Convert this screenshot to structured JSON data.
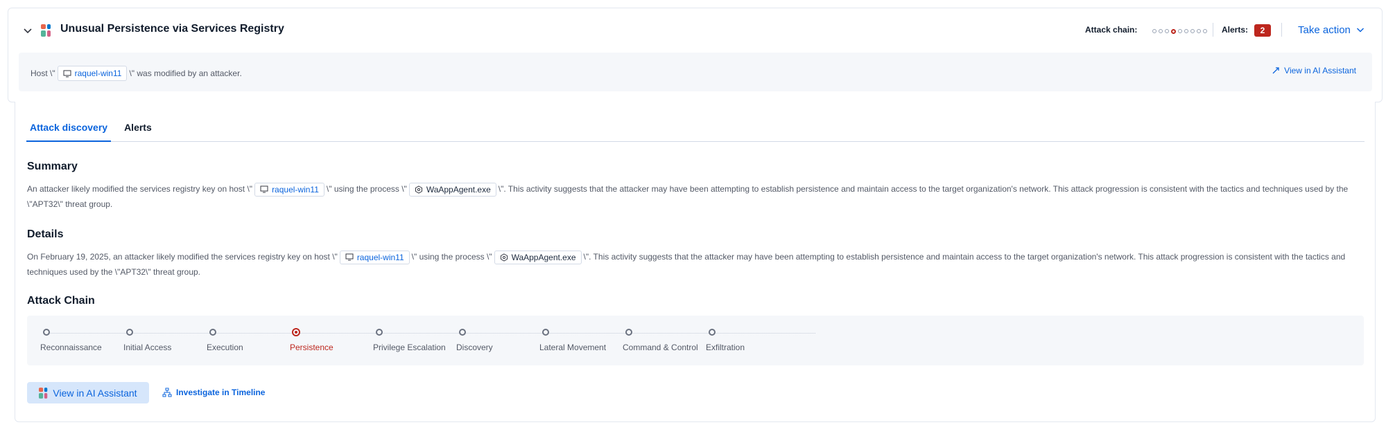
{
  "header": {
    "title": "Unusual Persistence via Services Registry",
    "attack_chain_label": "Attack chain:",
    "alerts_label": "Alerts:",
    "alerts_count": "2",
    "take_action_label": "Take action"
  },
  "host_banner": {
    "prefix": "Host \\\"",
    "host": "raquel-win11",
    "suffix": "\\\" was modified by an attacker.",
    "view_ai_label": "View in AI Assistant"
  },
  "tabs": [
    {
      "label": "Attack discovery",
      "active": true
    },
    {
      "label": "Alerts",
      "active": false
    }
  ],
  "summary": {
    "heading": "Summary",
    "t1": "An attacker likely modified the services registry key on host \\\"",
    "host": "raquel-win11",
    "t2": "\\\" using the process \\\"",
    "process": "WaAppAgent.exe",
    "t3": "\\\". This activity suggests that the attacker may have been attempting to establish persistence and maintain access to the target organization's network. This attack progression is consistent with the tactics and techniques used by the \\\"APT32\\\" threat group."
  },
  "details": {
    "heading": "Details",
    "t1": "On February 19, 2025, an attacker likely modified the services registry key on host \\\"",
    "host": "raquel-win11",
    "t2": "\\\" using the process \\\"",
    "process": "WaAppAgent.exe",
    "t3": "\\\". This activity suggests that the attacker may have been attempting to establish persistence and maintain access to the target organization's network. This attack progression is consistent with the tactics and techniques used by the \\\"APT32\\\" threat group."
  },
  "attack_chain": {
    "heading": "Attack Chain",
    "stages": [
      {
        "label": "Reconnaissance",
        "active": false
      },
      {
        "label": "Initial Access",
        "active": false
      },
      {
        "label": "Execution",
        "active": false
      },
      {
        "label": "Persistence",
        "active": true
      },
      {
        "label": "Privilege Escalation",
        "active": false
      },
      {
        "label": "Discovery",
        "active": false
      },
      {
        "label": "Lateral Movement",
        "active": false
      },
      {
        "label": "Command & Control",
        "active": false
      },
      {
        "label": "Exfiltration",
        "active": false
      }
    ]
  },
  "actions": {
    "view_ai_label": "View in AI Assistant",
    "investigate_label": "Investigate in Timeline"
  },
  "colors": {
    "accent": "#0b64dd",
    "danger": "#bd271e",
    "panel_bg": "#f5f7fa"
  },
  "icons": {
    "toggle": "chevron-down-icon",
    "logo": "ai-logo-icon",
    "host": "computer-icon",
    "process": "process-gear-icon",
    "expand": "expand-arrow-icon",
    "timeline": "timeline-icon"
  }
}
